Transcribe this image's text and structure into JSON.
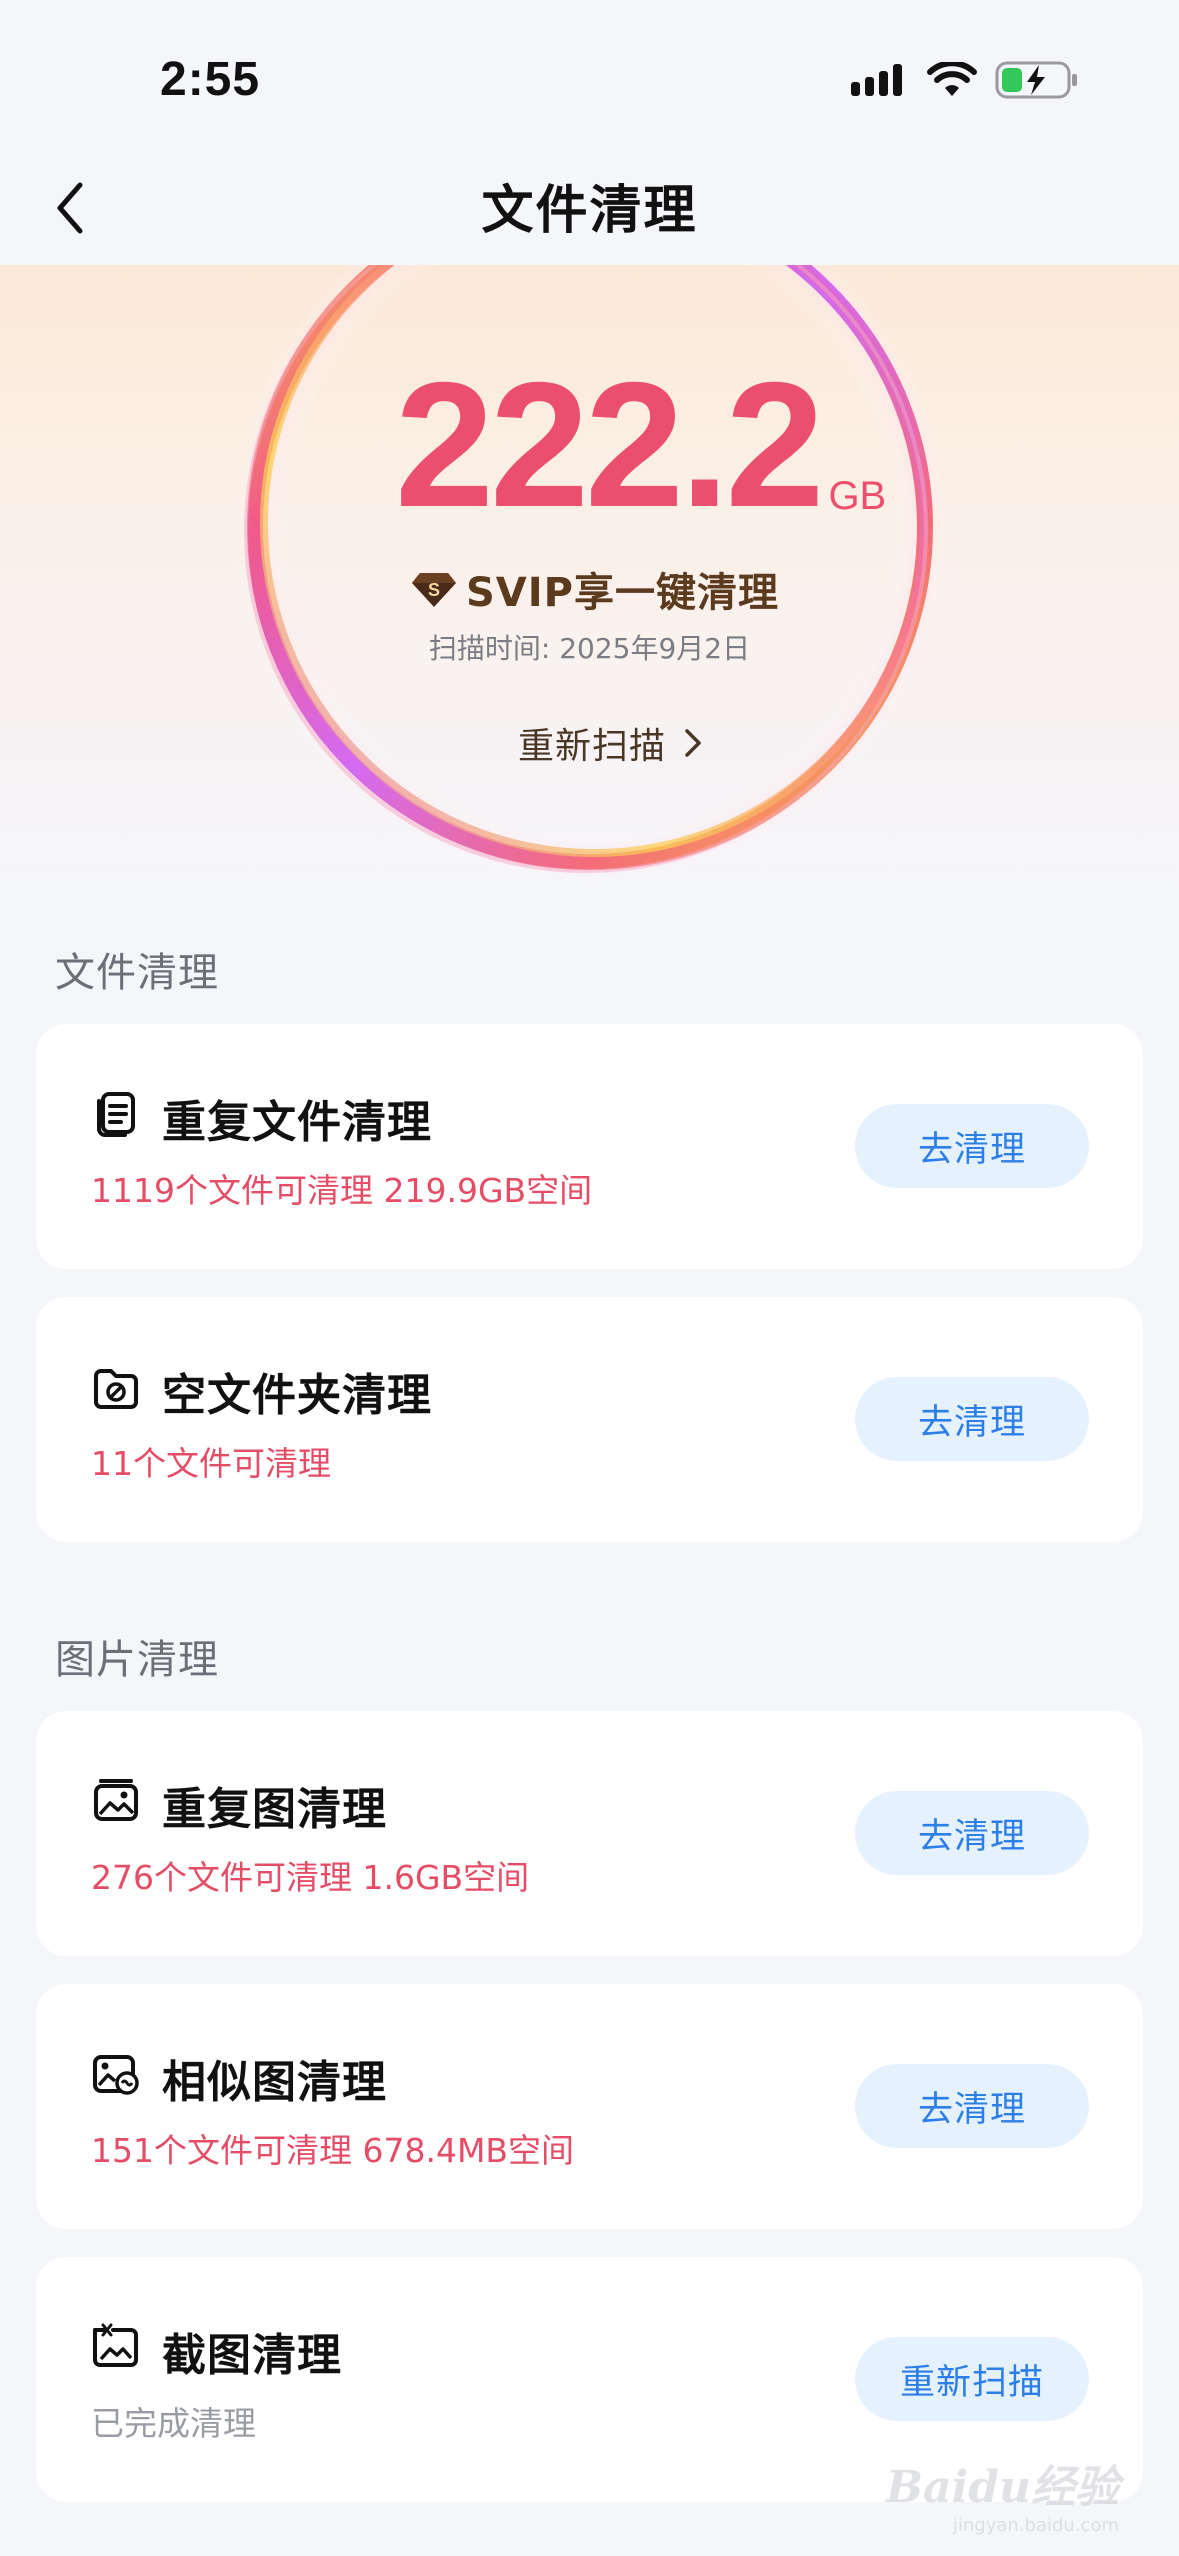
{
  "status_bar": {
    "time": "2:55",
    "icons": [
      "signal-icon",
      "wifi-icon",
      "battery-charging-icon"
    ]
  },
  "nav": {
    "title": "文件清理",
    "back_icon": "chevron-left-icon"
  },
  "hero": {
    "amount": "222.2",
    "unit": "GB",
    "svip_badge": "S",
    "svip_text": "SVIP享一键清理",
    "scan_time": "扫描时间: 2025年9月2日",
    "rescan_label": "重新扫描",
    "colors": {
      "amount": "#ec4f6e",
      "svip": "#5b3a1e"
    }
  },
  "sections": [
    {
      "title": "文件清理",
      "cards": [
        {
          "icon": "duplicate-file-icon",
          "title": "重复文件清理",
          "subtitle": "1119个文件可清理 219.9GB空间",
          "button": "去清理"
        },
        {
          "icon": "empty-folder-icon",
          "title": "空文件夹清理",
          "subtitle": "11个文件可清理",
          "button": "去清理"
        }
      ]
    },
    {
      "title": "图片清理",
      "cards": [
        {
          "icon": "duplicate-image-icon",
          "title": "重复图清理",
          "subtitle": "276个文件可清理 1.6GB空间",
          "button": "去清理"
        },
        {
          "icon": "similar-image-icon",
          "title": "相似图清理",
          "subtitle": "151个文件可清理 678.4MB空间",
          "button": "去清理"
        },
        {
          "icon": "screenshot-icon",
          "title": "截图清理",
          "subtitle": "已完成清理",
          "button": "重新扫描"
        }
      ]
    }
  ],
  "watermark": {
    "text": "Baidu经验",
    "url_text": "jingyan.baidu.com"
  },
  "theme": {
    "accent_blue": "#2c7ee8",
    "button_bg": "#e6f1fe",
    "alert_red": "#e54d67",
    "page_bg": "#f5f6fa"
  }
}
